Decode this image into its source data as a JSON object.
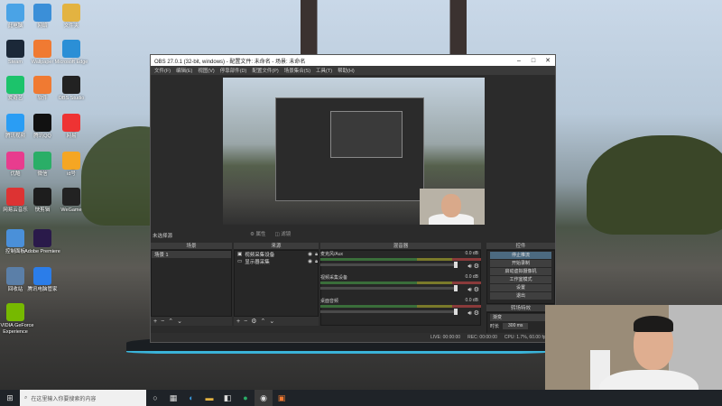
{
  "desktop": {
    "icons": [
      {
        "label": "此电脑",
        "color": "#4aa3e6"
      },
      {
        "label": "网络",
        "color": "#3b8fd8"
      },
      {
        "label": "文件夹",
        "color": "#e3b341"
      },
      {
        "label": "Steam",
        "color": "#1b2838"
      },
      {
        "label": "Wallpaper",
        "color": "#f07a32"
      },
      {
        "label": "Microsoft Edge",
        "color": "#2b8fd6"
      },
      {
        "label": "爱奇艺",
        "color": "#1cc36b"
      },
      {
        "label": "软件",
        "color": "#f07a32"
      },
      {
        "label": "OBS Studio",
        "color": "#222"
      },
      {
        "label": "腾讯视频",
        "color": "#2a9df4"
      },
      {
        "label": "腾讯QQ",
        "color": "#111"
      },
      {
        "label": "网易",
        "color": "#e33"
      },
      {
        "label": "优酷",
        "color": "#e83c8e"
      },
      {
        "label": "微信",
        "color": "#2aae67"
      },
      {
        "label": "id号",
        "color": "#f5a623"
      },
      {
        "label": "网易云音乐",
        "color": "#d33"
      },
      {
        "label": "快剪辑",
        "color": "#1d1d1d"
      },
      {
        "label": "WeGame",
        "color": "#222"
      },
      {
        "label": "控制面板",
        "color": "#4a90d9"
      },
      {
        "label": "Adobe Premiere",
        "color": "#2a1a4a"
      },
      {
        "label": "回收站",
        "color": "#5b7fa8"
      },
      {
        "label": "腾讯电脑管家",
        "color": "#2b7de9"
      },
      {
        "label": "NVIDIA GeForce Experience",
        "color": "#76b900"
      }
    ]
  },
  "obs": {
    "title": "OBS 27.0.1 (32-bit, windows) - 配置文件: 未命名 - 场景: 未命名",
    "menu": [
      "文件(F)",
      "编辑(E)",
      "视图(V)",
      "停靠部件(D)",
      "配置文件(P)",
      "场景集合(S)",
      "工具(T)",
      "帮助(H)"
    ],
    "no_source_label": "未选择源",
    "properties_btn": "属性",
    "filters_btn": "滤镜",
    "scenes": {
      "header": "场景",
      "items": [
        "场景 1"
      ]
    },
    "sources": {
      "header": "来源",
      "items": [
        "视频采集设备",
        "显示器采集"
      ]
    },
    "mixer": {
      "header": "混音器",
      "channels": [
        {
          "name": "麦克风/Aux",
          "db": "0.0 dB"
        },
        {
          "name": "视频采集设备",
          "db": "0.0 dB"
        },
        {
          "name": "桌面音频",
          "db": "0.0 dB"
        }
      ]
    },
    "transitions": {
      "header": "转场特效",
      "type": "渐变",
      "duration_label": "时长",
      "duration_value": "300 ms"
    },
    "controls": {
      "header": "控件",
      "buttons": [
        "停止推流",
        "开始录制",
        "启动虚拟摄像机",
        "工作室模式",
        "设置",
        "退出"
      ]
    },
    "status": {
      "live": "LIVE: 00:00:00",
      "rec": "REC: 00:00:00",
      "cpu": "CPU: 1.7%, 60.00 fps"
    }
  },
  "taskbar": {
    "search_placeholder": "在这里输入你要搜索的内容"
  },
  "colors": {
    "accent": "#4c6a80",
    "obs_bg": "#2b2b2b",
    "taskbar": "#1f2328"
  }
}
